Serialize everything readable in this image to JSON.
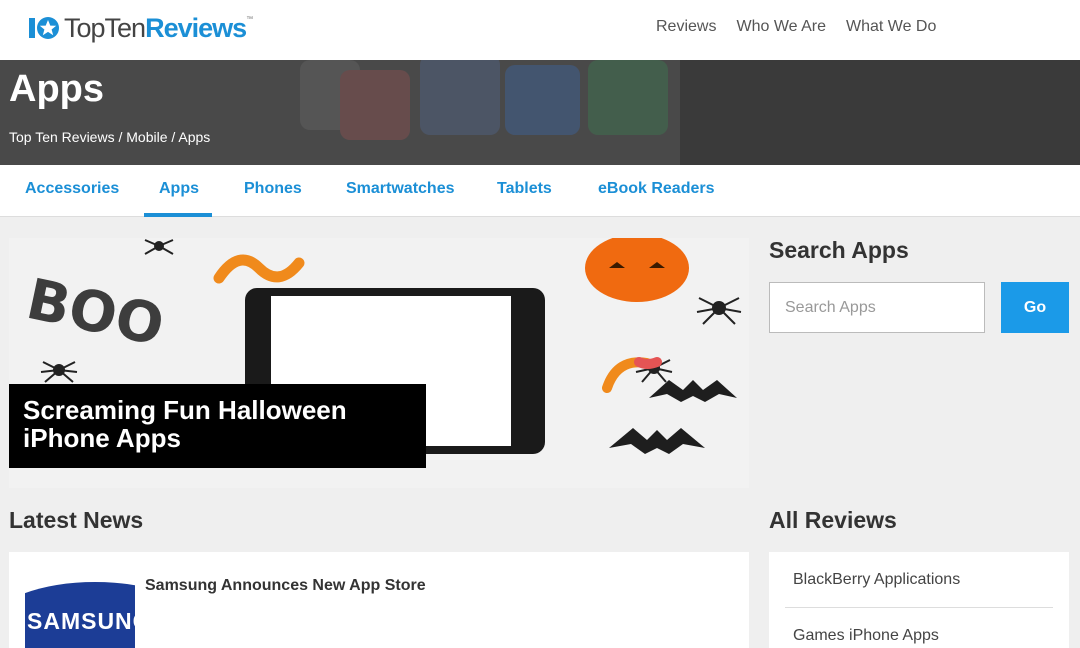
{
  "header": {
    "logo_word_1": "TopTen",
    "logo_word_2": "Reviews",
    "logo_tm": "™",
    "nav": [
      "Reviews",
      "Who We Are",
      "What We Do"
    ]
  },
  "hero": {
    "title": "Apps",
    "breadcrumb": "Top Ten Reviews / Mobile / Apps"
  },
  "subnav": {
    "tabs": [
      "Accessories",
      "Apps",
      "Phones",
      "Smartwatches",
      "Tablets",
      "eBook Readers"
    ],
    "active": "Apps"
  },
  "feature": {
    "title_line_1": "Screaming Fun Halloween",
    "title_line_2": "iPhone Apps",
    "boo_text": "BOO"
  },
  "search": {
    "title": "Search Apps",
    "placeholder": "Search Apps",
    "button": "Go"
  },
  "latest_news": {
    "title": "Latest News",
    "items": [
      {
        "headline": "Samsung Announces New App Store",
        "thumb_text": "SAMSUNG"
      }
    ]
  },
  "all_reviews": {
    "title": "All Reviews",
    "items": [
      "BlackBerry Applications",
      "Games iPhone Apps"
    ]
  },
  "colors": {
    "brand_blue": "#1b8fd6",
    "go_button": "#1b9ae8",
    "caption_bg": "#000000",
    "samsung_blue": "#1c3d96"
  }
}
